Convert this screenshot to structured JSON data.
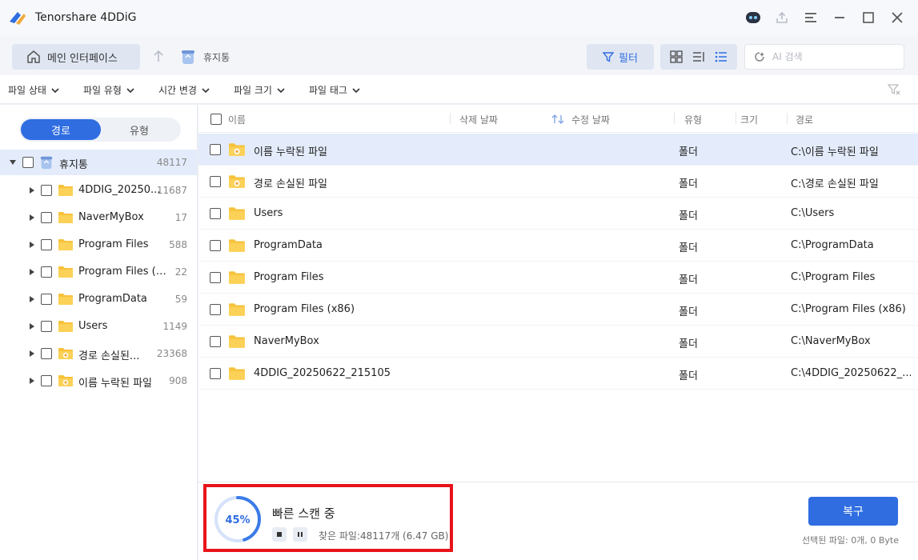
{
  "app": {
    "title": "Tenorshare 4DDiG"
  },
  "toolbar": {
    "home_label": "메인 인터페이스",
    "breadcrumb": "휴지통",
    "filter_label": "필터",
    "search_placeholder": "AI 검색"
  },
  "filters": {
    "file_status": "파일 상태",
    "file_type": "파일 유형",
    "time_changed": "시간 변경",
    "file_size": "파일 크기",
    "file_tag": "파일 태그"
  },
  "sidebar": {
    "tab_path": "경로",
    "tab_type": "유형",
    "root": {
      "label": "휴지통",
      "count": "48117"
    },
    "items": [
      {
        "label": "4DDIG_20250...",
        "count": "11687",
        "special": false
      },
      {
        "label": "NaverMyBox",
        "count": "17",
        "special": false
      },
      {
        "label": "Program Files",
        "count": "588",
        "special": false
      },
      {
        "label": "Program Files (x...",
        "count": "22",
        "special": false
      },
      {
        "label": "ProgramData",
        "count": "59",
        "special": false
      },
      {
        "label": "Users",
        "count": "1149",
        "special": false
      },
      {
        "label": "경로 손실된...",
        "count": "23368",
        "special": true
      },
      {
        "label": "이름 누락된 파일",
        "count": "908",
        "special": true
      }
    ]
  },
  "table": {
    "headers": {
      "name": "이름",
      "deleted_date": "삭제 날짜",
      "modified_date": "수정 날짜",
      "type": "유형",
      "size": "크기",
      "path": "경로"
    },
    "rows": [
      {
        "name": "이름 누락된 파일",
        "type": "폴더",
        "path": "C:\\이름 누락된 파일",
        "special": true
      },
      {
        "name": "경로 손실된 파일",
        "type": "폴더",
        "path": "C:\\경로 손실된 파일",
        "special": true
      },
      {
        "name": "Users",
        "type": "폴더",
        "path": "C:\\Users",
        "special": false
      },
      {
        "name": "ProgramData",
        "type": "폴더",
        "path": "C:\\ProgramData",
        "special": false
      },
      {
        "name": "Program Files",
        "type": "폴더",
        "path": "C:\\Program Files",
        "special": false
      },
      {
        "name": "Program Files (x86)",
        "type": "폴더",
        "path": "C:\\Program Files (x86)",
        "special": false
      },
      {
        "name": "NaverMyBox",
        "type": "폴더",
        "path": "C:\\NaverMyBox",
        "special": false
      },
      {
        "name": "4DDIG_20250622_215105",
        "type": "폴더",
        "path": "C:\\4DDIG_20250622_...",
        "special": false
      }
    ]
  },
  "scan": {
    "progress_percent": 45,
    "progress_label": "45%",
    "title": "빠른 스캔 중",
    "found_text": "찾은 파일:48117개 (6.47 GB)"
  },
  "footer": {
    "recover_label": "복구",
    "selected_info": "선택된 파일: 0개, 0 Byte"
  },
  "colors": {
    "accent": "#2f6de1",
    "highlight_box": "#e8141b",
    "folder": "#f7c23a",
    "selected_row": "#e4ecfb"
  }
}
